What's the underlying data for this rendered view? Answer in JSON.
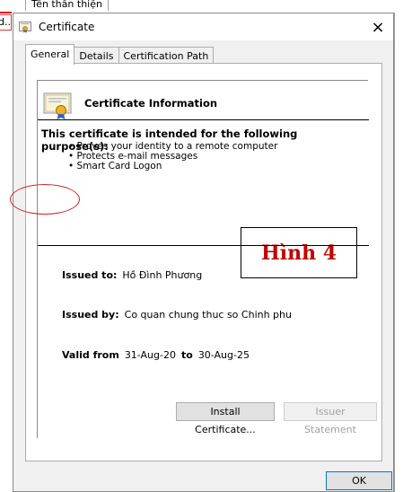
{
  "background": {
    "header_cell": "Tên thân thiện",
    "button_fragment": "d..."
  },
  "dialog": {
    "title": "Certificate",
    "close_glyph": "×",
    "tabs": [
      {
        "label": "General",
        "active": true
      },
      {
        "label": "Details",
        "active": false
      },
      {
        "label": "Certification Path",
        "active": false
      }
    ],
    "info_title": "Certificate Information",
    "purpose_title": "This certificate is intended for the following purpose(s):",
    "purposes": [
      "Proves your identity to a remote computer",
      "Protects e-mail messages",
      "Smart Card Logon"
    ],
    "issued_to_label": "Issued to:",
    "issued_to_value": "Hồ Đình Phương",
    "issued_by_label": "Issued by:",
    "issued_by_value": "Co quan chung thuc so Chinh phu",
    "valid_from_label": "Valid from",
    "valid_from_value": "31-Aug-20",
    "valid_to_label": "to",
    "valid_to_value": "30-Aug-25",
    "install_button": "Install Certificate...",
    "issuer_button": "Issuer Statement",
    "ok_button": "OK"
  },
  "overlay": {
    "figure_label": "Hình 4",
    "accent_red": "#c00000",
    "mark_color": "#d42020"
  },
  "icons": {
    "title_icon": "certificate-icon",
    "info_icon": "certificate-ribbon-icon"
  }
}
